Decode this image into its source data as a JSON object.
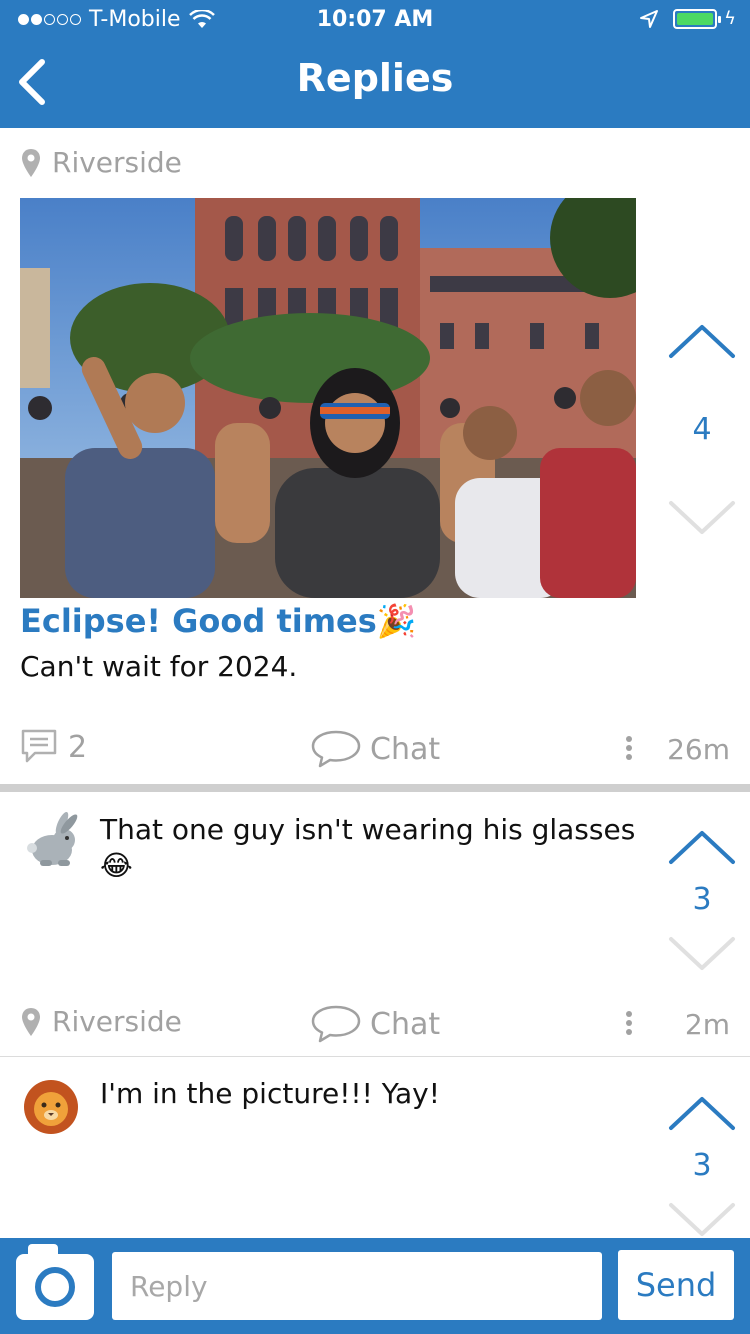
{
  "status_bar": {
    "carrier": "T-Mobile",
    "time": "10:07 AM"
  },
  "header": {
    "title": "Replies"
  },
  "post": {
    "location": "Riverside",
    "title": "Eclipse! Good times",
    "title_emoji": "🎉",
    "body": "Can't wait for 2024.",
    "votes": "4",
    "comment_count": "2",
    "chat_label": "Chat",
    "time": "26m"
  },
  "replies": [
    {
      "text": "That one guy isn't wearing his glasses",
      "emoji": "😂",
      "votes": "3",
      "location": "Riverside",
      "chat_label": "Chat",
      "time": "2m",
      "avatar": "rabbit-icon"
    },
    {
      "text": "I'm in the picture!!! Yay!",
      "votes": "3",
      "avatar": "lion-icon"
    }
  ],
  "composer": {
    "placeholder": "Reply",
    "send_label": "Send"
  },
  "colors": {
    "brand": "#2b7bc1",
    "muted": "#a1a1a1",
    "battery": "#4cd964"
  }
}
